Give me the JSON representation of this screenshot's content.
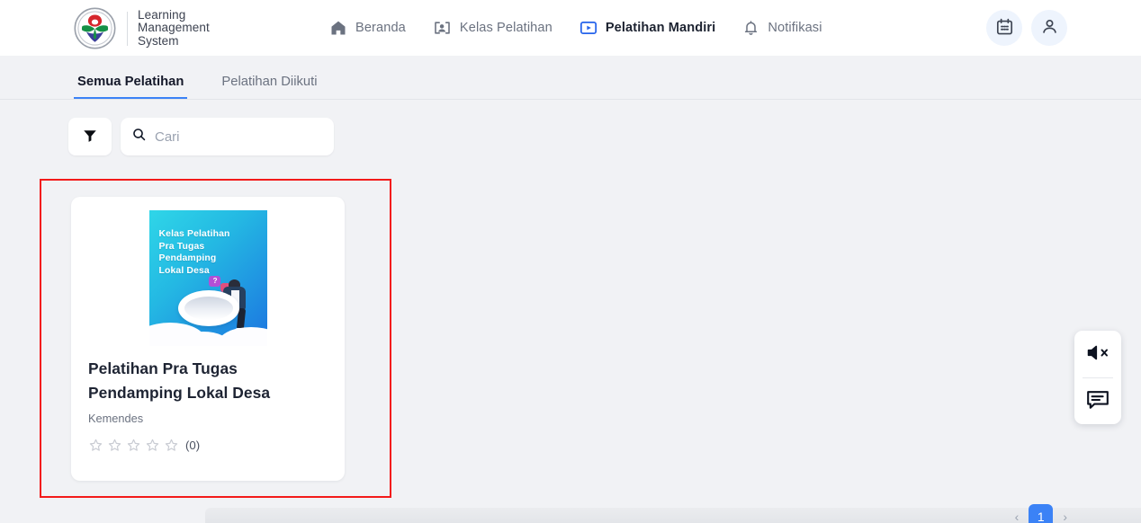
{
  "header": {
    "brand": {
      "logo_icon": "lms-emblem-logo",
      "title": "Learning\nManagement\nSystem"
    },
    "nav": [
      {
        "id": "beranda",
        "label": "Beranda",
        "icon": "home-icon",
        "active": false
      },
      {
        "id": "kelas-pelatihan",
        "label": "Kelas Pelatihan",
        "icon": "person-card-icon",
        "active": false
      },
      {
        "id": "pelatihan-mandiri",
        "label": "Pelatihan Mandiri",
        "icon": "play-box-icon",
        "active": true
      },
      {
        "id": "notifikasi",
        "label": "Notifikasi",
        "icon": "bell-icon",
        "active": false
      }
    ],
    "actions": [
      {
        "id": "calendar",
        "icon": "calendar-icon"
      },
      {
        "id": "account",
        "icon": "user-icon"
      }
    ]
  },
  "tabs": [
    {
      "id": "semua-pelatihan",
      "label": "Semua Pelatihan",
      "active": true
    },
    {
      "id": "pelatihan-diikuti",
      "label": "Pelatihan Diikuti",
      "active": false
    }
  ],
  "toolbar": {
    "filter_icon": "filter-funnel-icon",
    "search": {
      "icon": "search-icon",
      "placeholder": "Cari",
      "value": ""
    }
  },
  "course_card": {
    "thumbnail": {
      "text": "Kelas Pelatihan\nPra Tugas\nPendamping\nLokal Desa",
      "gradient_from": "#2fd6e8",
      "gradient_to": "#1c74e0"
    },
    "title": "Pelatihan Pra Tugas Pendamping Lokal Desa",
    "provider": "Kemendes",
    "rating": {
      "stars_total": 5,
      "stars_filled": 0,
      "count_label": "(0)"
    },
    "selected": true,
    "selection_color": "#f31a1a"
  },
  "floating_widget": {
    "buttons": [
      {
        "id": "mute",
        "icon": "speaker-mute-icon"
      },
      {
        "id": "chat",
        "icon": "chat-bubble-icon"
      }
    ]
  },
  "pagination": {
    "prev_label": "‹",
    "next_label": "›",
    "pages": [
      "1"
    ],
    "current": "1",
    "accent_color": "#3b82f6"
  }
}
